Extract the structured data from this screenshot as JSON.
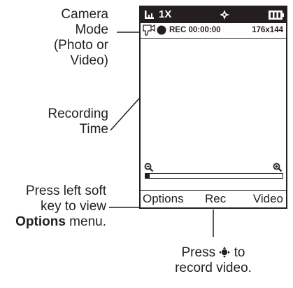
{
  "callouts": {
    "camera_mode": [
      "Camera",
      "Mode",
      "(Photo or",
      "Video)"
    ],
    "recording_time": [
      "Recording",
      "Time"
    ],
    "options": {
      "line1": "Press left soft",
      "line2": "key to view",
      "bold": "Options",
      "suffix": " menu."
    },
    "record": {
      "prefix": "Press ",
      "suffix": " to",
      "line2": "record video."
    }
  },
  "phone": {
    "status": {
      "network": "1X"
    },
    "info": {
      "rec": "REC 00:00:00",
      "resolution": "176x144"
    },
    "softkeys": {
      "left": "Options",
      "center": "Rec",
      "right": "Video"
    },
    "zoom_level": 0.02
  },
  "colors": {
    "ink": "#231f20"
  }
}
